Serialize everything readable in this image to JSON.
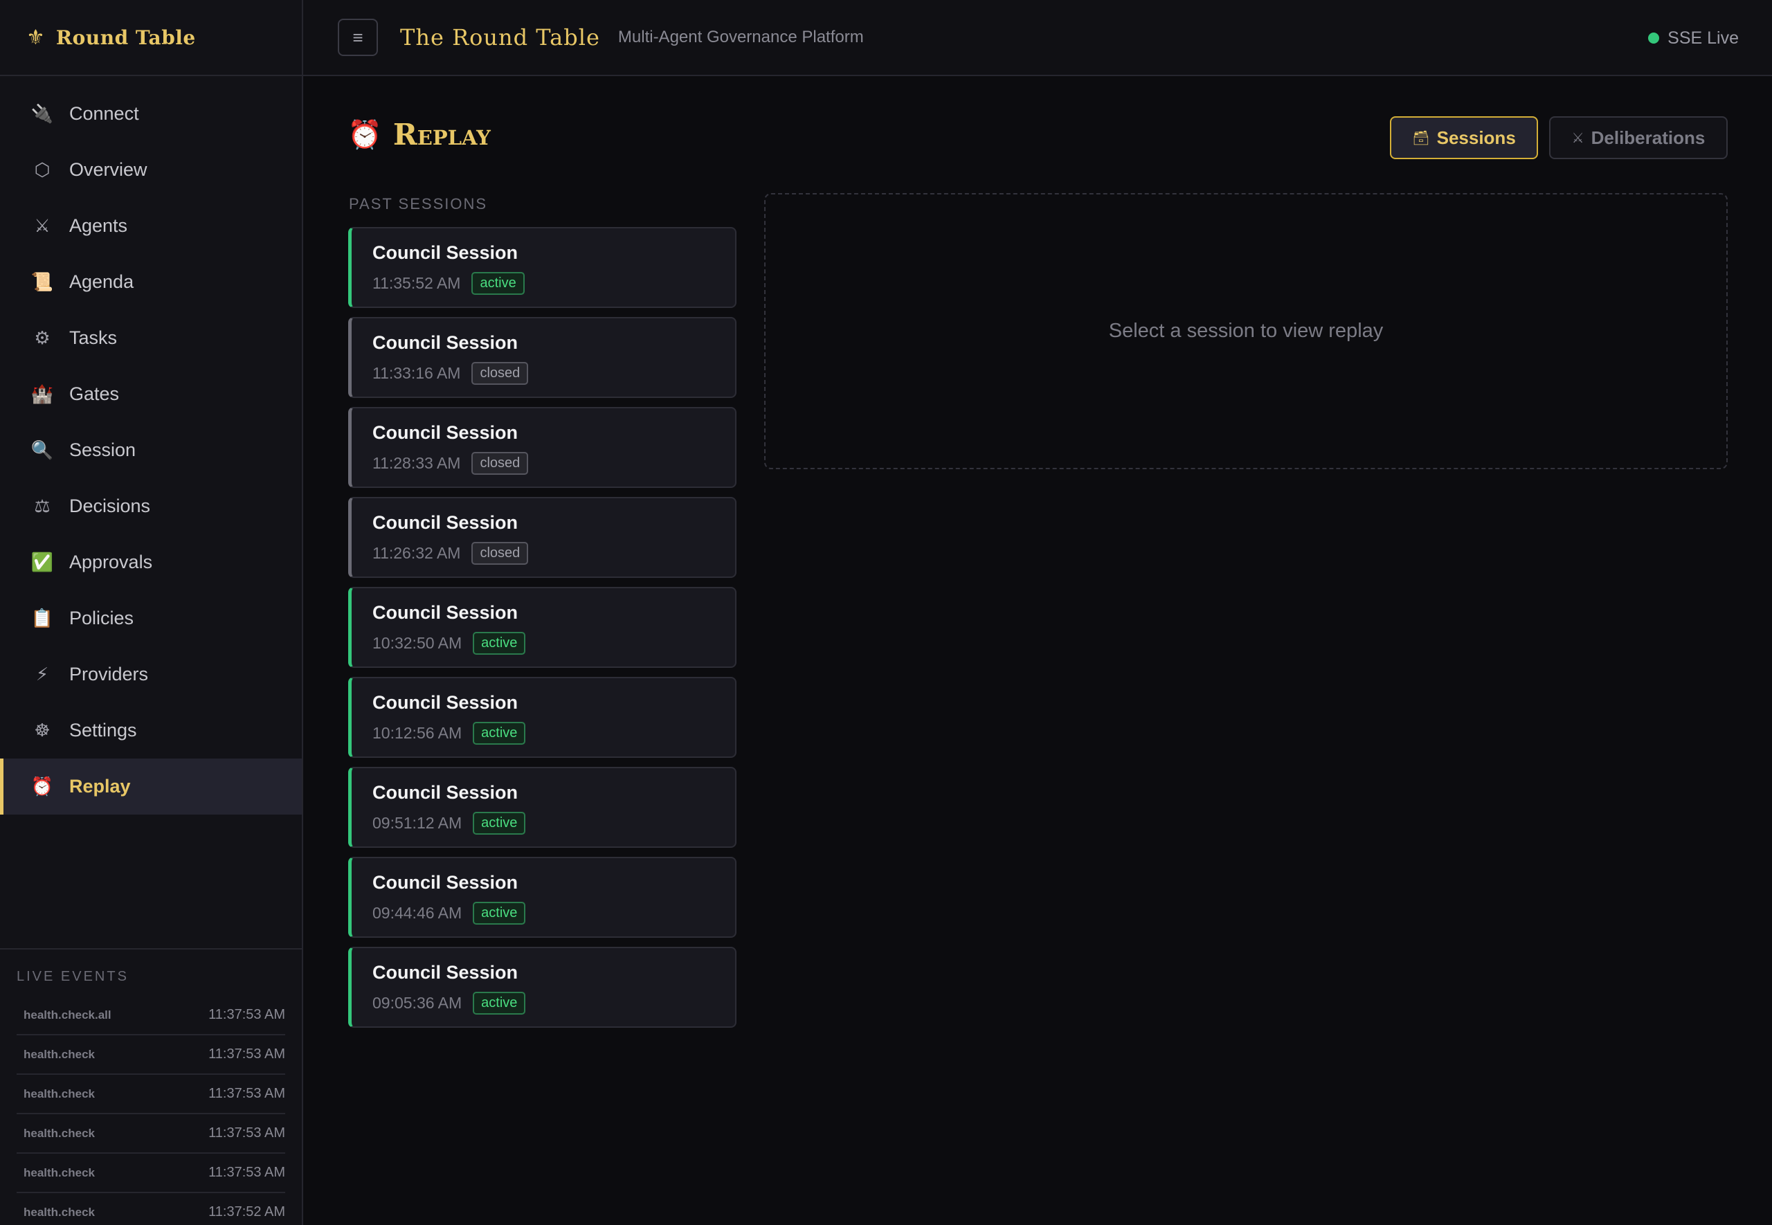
{
  "brand": {
    "icon": "fleur-de-lis-icon",
    "name": "Round Table"
  },
  "topbar": {
    "title": "The Round Table",
    "subtitle": "Multi-Agent Governance Platform",
    "status": "SSE Live",
    "status_color": "#34c77b"
  },
  "sidebar": {
    "items": [
      {
        "label": "Connect",
        "icon": "🔌"
      },
      {
        "label": "Overview",
        "icon": "⬡"
      },
      {
        "label": "Agents",
        "icon": "⚔"
      },
      {
        "label": "Agenda",
        "icon": "📜"
      },
      {
        "label": "Tasks",
        "icon": "⚙"
      },
      {
        "label": "Gates",
        "icon": "🏰"
      },
      {
        "label": "Session",
        "icon": "🔍"
      },
      {
        "label": "Decisions",
        "icon": "⚖"
      },
      {
        "label": "Approvals",
        "icon": "✅"
      },
      {
        "label": "Policies",
        "icon": "📋"
      },
      {
        "label": "Providers",
        "icon": "⚡"
      },
      {
        "label": "Settings",
        "icon": "☸"
      },
      {
        "label": "Replay",
        "icon": "⏰"
      }
    ],
    "active": "Replay"
  },
  "live_events": {
    "header": "LIVE EVENTS",
    "items": [
      {
        "name": "health.check.all",
        "time": "11:37:53 AM"
      },
      {
        "name": "health.check",
        "time": "11:37:53 AM"
      },
      {
        "name": "health.check",
        "time": "11:37:53 AM"
      },
      {
        "name": "health.check",
        "time": "11:37:53 AM"
      },
      {
        "name": "health.check",
        "time": "11:37:53 AM"
      },
      {
        "name": "health.check",
        "time": "11:37:52 AM"
      }
    ]
  },
  "page": {
    "icon": "⏰",
    "title": "Replay",
    "tabs": {
      "sessions": {
        "icon": "🗃",
        "label": "Sessions"
      },
      "deliberations": {
        "icon": "⚔",
        "label": "Deliberations"
      }
    },
    "past_label": "PAST SESSIONS",
    "sessions": [
      {
        "title": "Council Session",
        "time": "11:35:52 AM",
        "status": "active"
      },
      {
        "title": "Council Session",
        "time": "11:33:16 AM",
        "status": "closed"
      },
      {
        "title": "Council Session",
        "time": "11:28:33 AM",
        "status": "closed"
      },
      {
        "title": "Council Session",
        "time": "11:26:32 AM",
        "status": "closed"
      },
      {
        "title": "Council Session",
        "time": "10:32:50 AM",
        "status": "active"
      },
      {
        "title": "Council Session",
        "time": "10:12:56 AM",
        "status": "active"
      },
      {
        "title": "Council Session",
        "time": "09:51:12 AM",
        "status": "active"
      },
      {
        "title": "Council Session",
        "time": "09:44:46 AM",
        "status": "active"
      },
      {
        "title": "Council Session",
        "time": "09:05:36 AM",
        "status": "active"
      }
    ],
    "empty_message": "Select a session to view replay"
  },
  "colors": {
    "accent": "#e8c766",
    "active_green": "#34c77b",
    "background": "#0c0c0f"
  }
}
